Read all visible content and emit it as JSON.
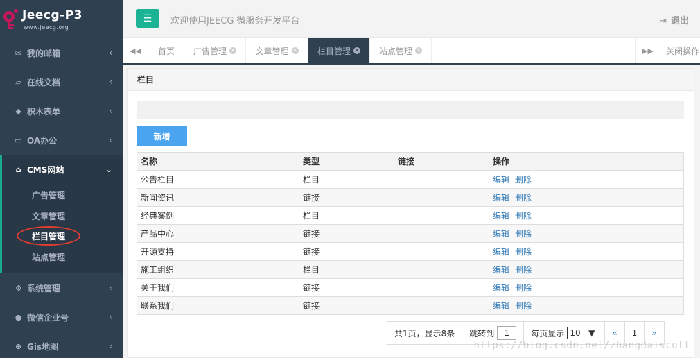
{
  "brand": {
    "title": "Jeecg-P3",
    "subtitle": "www.jeecg.org"
  },
  "header": {
    "welcome": "欢迎使用JEECG 微服务开发平台",
    "logout": "退出"
  },
  "sidebar": {
    "items": [
      {
        "label": "我的邮箱",
        "icon": "envelope-icon"
      },
      {
        "label": "在线文档",
        "icon": "folder-open-icon"
      },
      {
        "label": "积木表单",
        "icon": "cube-icon"
      },
      {
        "label": "OA办公",
        "icon": "laptop-icon"
      },
      {
        "label": "CMS网站",
        "icon": "home-icon"
      },
      {
        "label": "系统管理",
        "icon": "gear-icon"
      },
      {
        "label": "微信企业号",
        "icon": "comments-icon"
      },
      {
        "label": "Gis地图",
        "icon": "globe-icon"
      }
    ],
    "cms_sub": [
      "广告管理",
      "文章管理",
      "栏目管理",
      "站点管理"
    ]
  },
  "tabs": [
    "首页",
    "广告管理",
    "文章管理",
    "栏目管理",
    "站点管理"
  ],
  "tab_close_all": "关闭操作",
  "panel": {
    "title": "栏目",
    "add_label": "新增"
  },
  "table": {
    "headers": [
      "名称",
      "类型",
      "链接",
      "操作"
    ],
    "rows": [
      {
        "name": "公告栏目",
        "type": "栏目",
        "link": ""
      },
      {
        "name": "新闻资讯",
        "type": "链接",
        "link": ""
      },
      {
        "name": "经典案例",
        "type": "栏目",
        "link": ""
      },
      {
        "name": "产品中心",
        "type": "链接",
        "link": ""
      },
      {
        "name": "开源支持",
        "type": "链接",
        "link": ""
      },
      {
        "name": "施工组织",
        "type": "栏目",
        "link": ""
      },
      {
        "name": "关于我们",
        "type": "链接",
        "link": ""
      },
      {
        "name": "联系我们",
        "type": "链接",
        "link": ""
      }
    ],
    "edit_label": "编辑",
    "delete_label": "删除"
  },
  "pager": {
    "summary": "共1页，显示8条",
    "jump_label": "跳转到",
    "jump_value": "1",
    "size_label": "每页显示",
    "size_value": "10",
    "prev": "«",
    "current": "1",
    "next": "»"
  },
  "watermark": "https://blog.csdn.net/zhangdaiscott",
  "colors": {
    "sidebar": "#2f4050",
    "accent": "#1ab394",
    "button": "#4ba4f0",
    "highlight": "#e03c31"
  }
}
